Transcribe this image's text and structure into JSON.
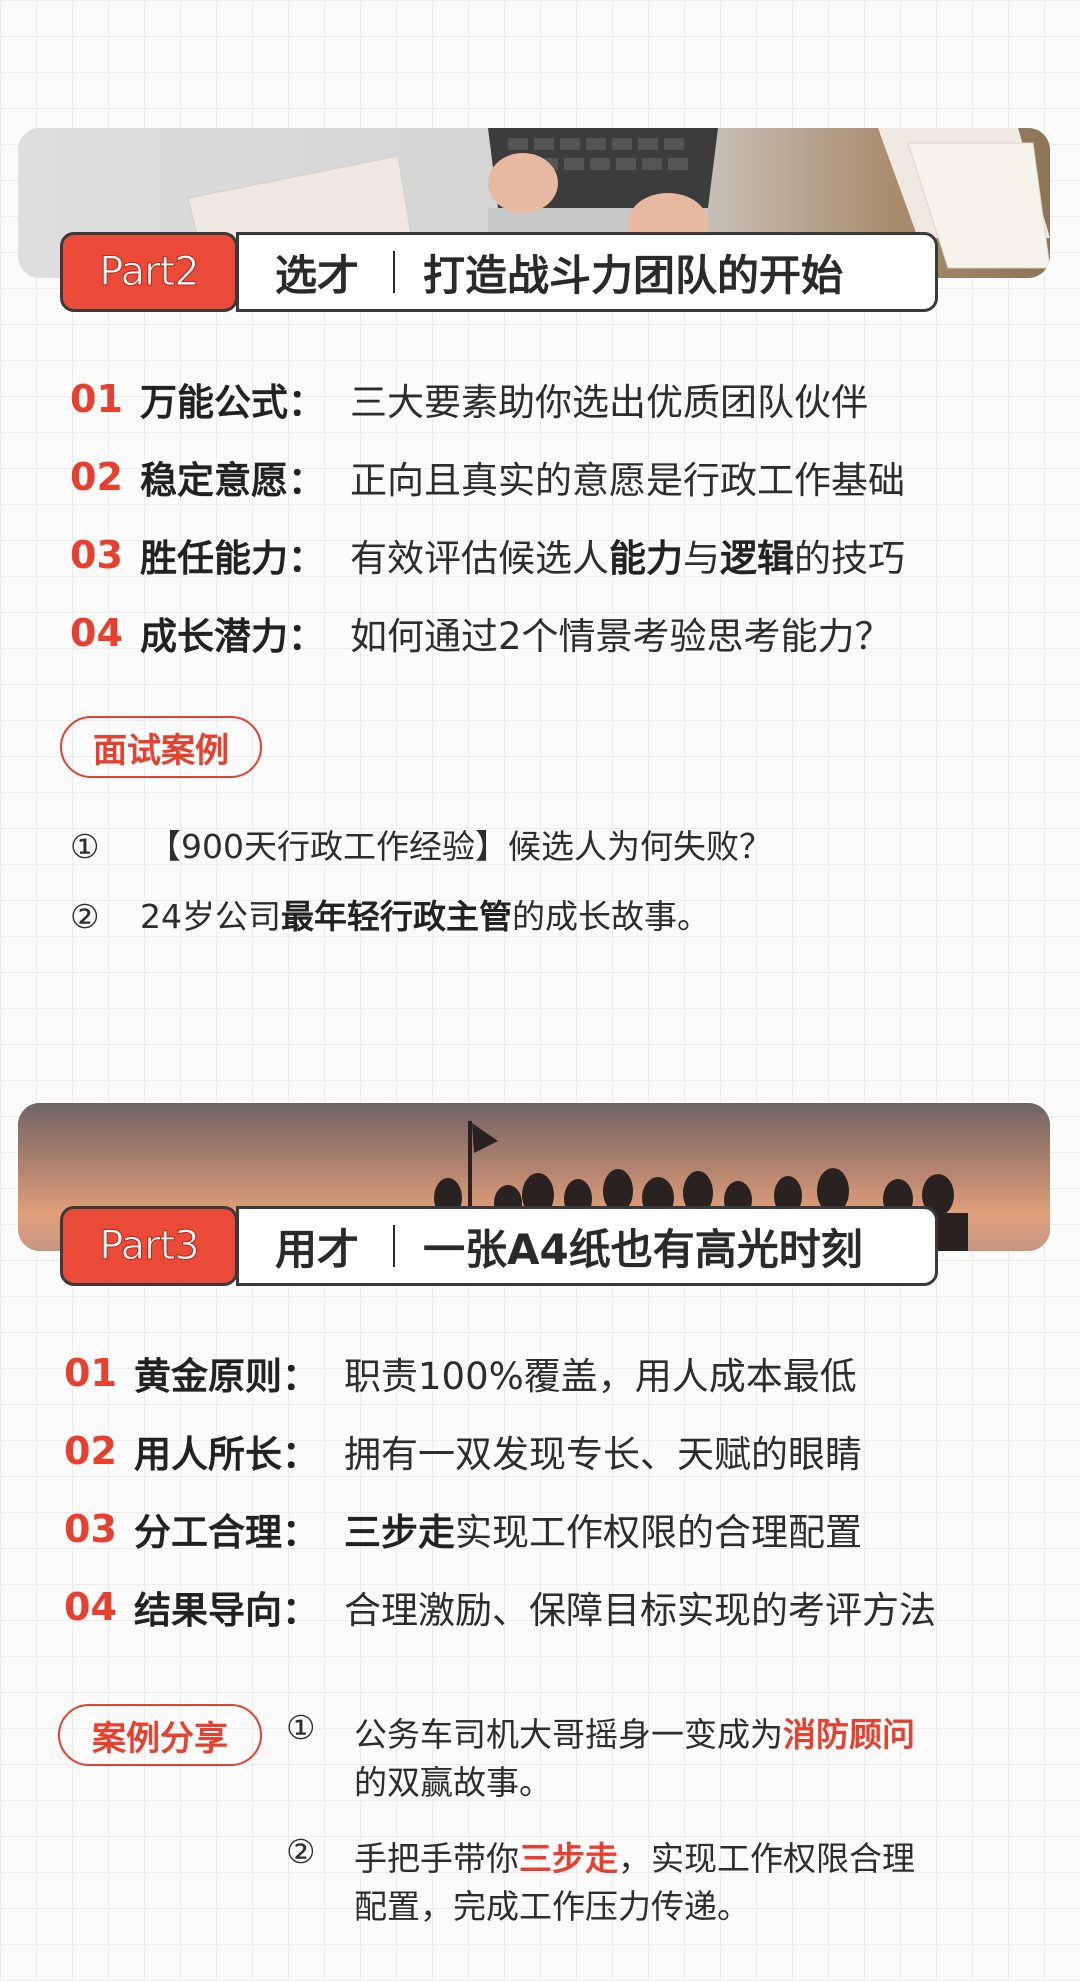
{
  "part2": {
    "tag": "Part2",
    "title_left": "选才",
    "title_right": "打造战斗力团队的开始",
    "items": [
      {
        "num": "01",
        "key": "万能公式：",
        "segments": [
          {
            "text": "三大要素助你选出优质团队伙伴",
            "bold": false
          }
        ]
      },
      {
        "num": "02",
        "key": "稳定意愿：",
        "segments": [
          {
            "text": "正向且真实的意愿是行政工作基础",
            "bold": false
          }
        ]
      },
      {
        "num": "03",
        "key": "胜任能力：",
        "segments": [
          {
            "text": "有效评估候选人",
            "bold": false
          },
          {
            "text": "能力",
            "bold": true
          },
          {
            "text": "与",
            "bold": false
          },
          {
            "text": "逻辑",
            "bold": true
          },
          {
            "text": "的技巧",
            "bold": false
          }
        ]
      },
      {
        "num": "04",
        "key": "成长潜力：",
        "segments": [
          {
            "text": "如何通过2个情景考验思考能力？",
            "bold": false
          }
        ]
      }
    ],
    "case_badge": "面试案例",
    "cases": [
      {
        "mark": "①",
        "segments": [
          {
            "text": "【900天行政工作经验】候选人为何失败？",
            "bold": false
          }
        ]
      },
      {
        "mark": "②",
        "segments": [
          {
            "text": "24岁公司",
            "bold": false
          },
          {
            "text": "最年轻行政主管",
            "bold": true
          },
          {
            "text": "的成长故事。",
            "bold": false
          }
        ]
      }
    ]
  },
  "part3": {
    "tag": "Part3",
    "title_left": "用才",
    "title_right": "一张A4纸也有高光时刻",
    "items": [
      {
        "num": "01",
        "key": "黄金原则：",
        "segments": [
          {
            "text": "职责100%覆盖，用人成本最低",
            "bold": false
          }
        ]
      },
      {
        "num": "02",
        "key": "用人所长：",
        "segments": [
          {
            "text": "拥有一双发现专长、天赋的眼睛",
            "bold": false
          }
        ]
      },
      {
        "num": "03",
        "key": "分工合理：",
        "segments": [
          {
            "text": "三步走",
            "bold": true
          },
          {
            "text": "实现工作权限的合理配置",
            "bold": false
          }
        ]
      },
      {
        "num": "04",
        "key": "结果导向：",
        "segments": [
          {
            "text": "合理激励、保障目标实现的考评方法",
            "bold": false
          }
        ]
      }
    ],
    "case_badge": "案例分享",
    "cases": [
      {
        "mark": "①",
        "line1": [
          {
            "text": "公务车司机大哥摇身一变成为",
            "red": false
          },
          {
            "text": "消防顾问",
            "red": true
          }
        ],
        "line2": "的双赢故事。"
      },
      {
        "mark": "②",
        "line1": [
          {
            "text": "手把手带你",
            "red": false
          },
          {
            "text": "三步走",
            "red": true
          },
          {
            "text": "，实现工作权限合理",
            "red": false
          }
        ],
        "line2": "配置，完成工作压力传递。"
      }
    ]
  },
  "colors": {
    "accent": "#e8402f",
    "tag_bg": "#ea4a37",
    "text": "#262626"
  }
}
